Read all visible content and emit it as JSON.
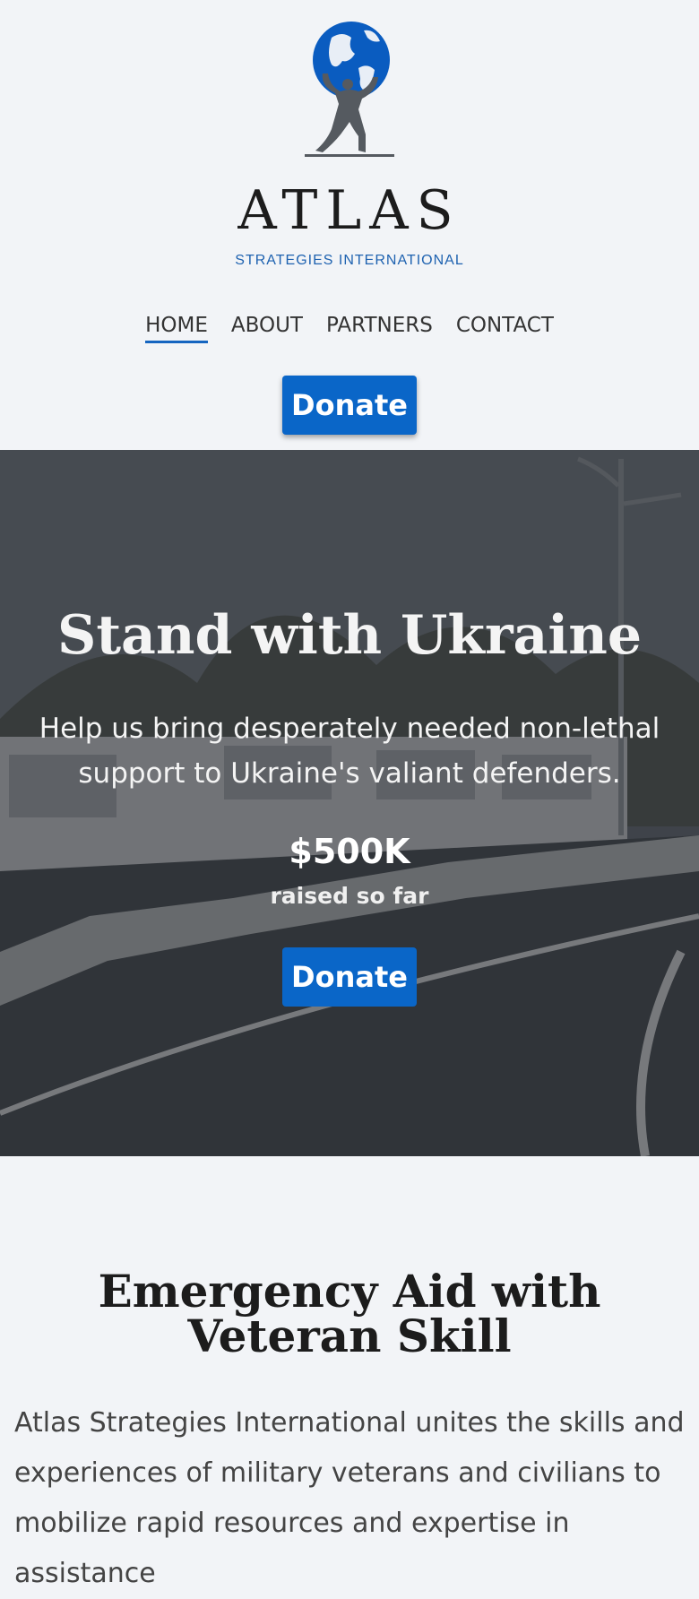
{
  "brand": {
    "name": "ATLAS",
    "subtitle": "STRATEGIES INTERNATIONAL"
  },
  "nav": {
    "items": [
      {
        "label": "HOME",
        "active": true
      },
      {
        "label": "ABOUT",
        "active": false
      },
      {
        "label": "PARTNERS",
        "active": false
      },
      {
        "label": "CONTACT",
        "active": false
      }
    ]
  },
  "header": {
    "donate_label": "Donate"
  },
  "hero": {
    "title": "Stand with Ukraine",
    "subtitle": "Help us bring desperately needed non-lethal support to Ukraine's valiant defenders.",
    "amount": "$500K",
    "amount_caption": "raised so far",
    "donate_label": "Donate"
  },
  "about": {
    "title": "Emergency Aid with Veteran Skill",
    "text": "Atlas Strategies International unites the skills and experiences of military veterans and civilians to mobilize rapid resources and expertise in assistance"
  },
  "colors": {
    "accent": "#0a66c8",
    "background": "#f2f4f7",
    "brand_subtitle": "#1e62b0"
  }
}
